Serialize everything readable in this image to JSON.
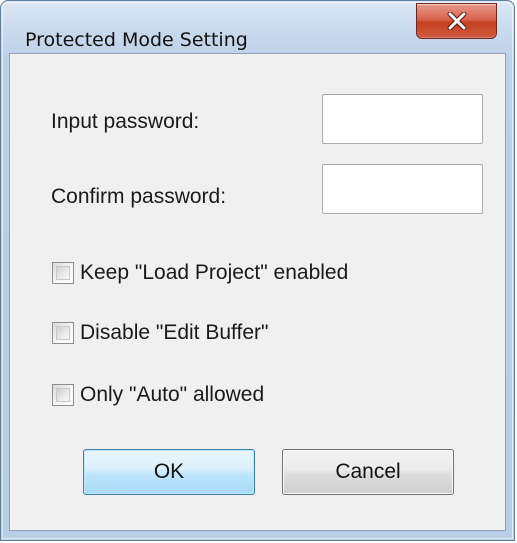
{
  "window": {
    "title": "Protected Mode Setting"
  },
  "fields": {
    "input_password_label": "Input password:",
    "input_password_value": "",
    "confirm_password_label": "Confirm password:",
    "confirm_password_value": ""
  },
  "options": [
    {
      "label": "Keep \"Load Project\" enabled",
      "checked": false
    },
    {
      "label": "Disable \"Edit Buffer\"",
      "checked": false
    },
    {
      "label": "Only \"Auto\" allowed",
      "checked": false
    }
  ],
  "buttons": {
    "ok_label": "OK",
    "cancel_label": "Cancel"
  },
  "icons": {
    "close": "close-icon"
  },
  "colors": {
    "title_bar": "#c9daee",
    "close_button": "#c6401f",
    "client_background": "#f0f0f0",
    "default_button_border": "#3c7fb1"
  }
}
